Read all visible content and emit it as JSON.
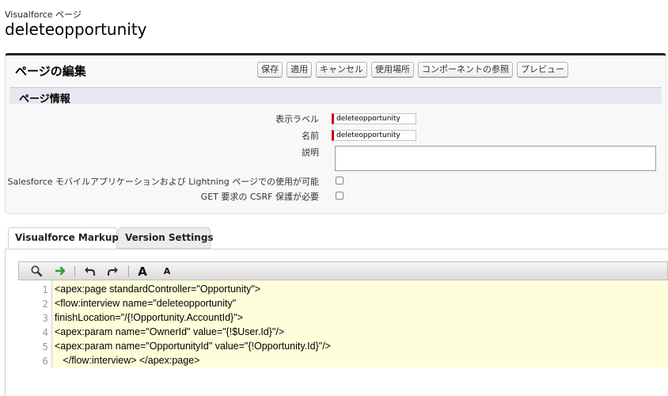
{
  "header": {
    "subtitle": "Visualforce ページ",
    "title": "deleteopportunity"
  },
  "panel": {
    "title": "ページの編集",
    "buttons": [
      "保存",
      "適用",
      "キャンセル",
      "使用場所",
      "コンポーネントの参照",
      "プレビュー"
    ]
  },
  "section": {
    "title": "ページ情報"
  },
  "form": {
    "label_field": {
      "label": "表示ラベル",
      "value": "deleteopportunity"
    },
    "name_field": {
      "label": "名前",
      "value": "deleteopportunity"
    },
    "description_field": {
      "label": "説明",
      "value": ""
    },
    "mobile_lightning": {
      "label": "Salesforce モバイルアプリケーションおよび Lightning ページでの使用が可能",
      "checked": false
    },
    "csrf": {
      "label": "GET 要求の CSRF 保護が必要",
      "checked": false
    }
  },
  "tabs": [
    {
      "label": "Visualforce Markup",
      "active": true
    },
    {
      "label": "Version Settings",
      "active": false
    }
  ],
  "toolbar": {
    "icons": [
      "search-icon",
      "go-to-line-icon",
      "undo-icon",
      "redo-icon",
      "increase-font-icon",
      "decrease-font-icon"
    ],
    "font_large": "A",
    "font_small": "A"
  },
  "editor": {
    "lines": [
      {
        "num": "1",
        "code": "<apex:page standardController=\"Opportunity\">"
      },
      {
        "num": "2",
        "code": "<flow:interview name=\"deleteopportunity\""
      },
      {
        "num": "3",
        "code": "finishLocation=\"/{!Opportunity.AccountId}\">"
      },
      {
        "num": "4",
        "code": "<apex:param name=\"OwnerId\" value=\"{!$User.Id}\"/>"
      },
      {
        "num": "5",
        "code": "<apex:param name=\"OpportunityId\" value=\"{!Opportunity.Id}\"/>"
      },
      {
        "num": "6",
        "code": "   </flow:interview> </apex:page>"
      }
    ]
  },
  "colors": {
    "required_marker": "#c00000",
    "code_background": "#fefedb",
    "section_background": "#e5e9ef",
    "goto_arrow": "#2aa02a"
  }
}
